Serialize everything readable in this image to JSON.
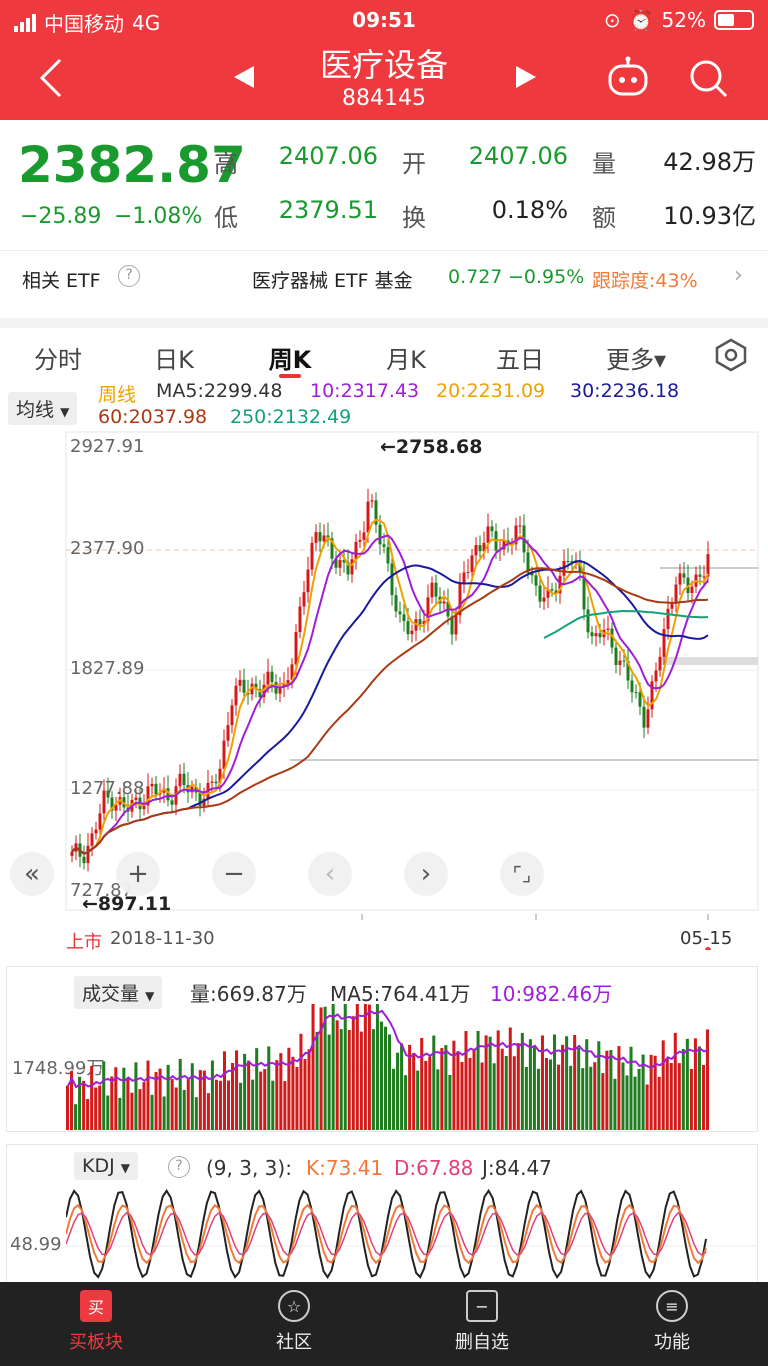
{
  "status_bar": {
    "carrier": "中国移动",
    "network": "4G",
    "time": "09:51",
    "battery": "52%"
  },
  "nav": {
    "title": "医疗设备",
    "code": "884145"
  },
  "quote": {
    "price": "2382.87",
    "change": "−25.89",
    "change_pct": "−1.08%",
    "high_label": "高",
    "high": "2407.06",
    "low_label": "低",
    "low": "2379.51",
    "open_label": "开",
    "open": "2407.06",
    "turnover_label": "换",
    "turnover": "0.18%",
    "volume_label": "量",
    "volume": "42.98万",
    "amount_label": "额",
    "amount": "10.93亿"
  },
  "etf": {
    "label": "相关 ETF",
    "name": "医疗器械 ETF 基金",
    "price": "0.727",
    "change": "−0.95%",
    "track": "跟踪度:43%"
  },
  "tabs": [
    {
      "label": "分时"
    },
    {
      "label": "日K"
    },
    {
      "label": "周K"
    },
    {
      "label": "月K"
    },
    {
      "label": "五日"
    },
    {
      "label": "更多▾"
    }
  ],
  "ma_legend": {
    "selector": "均线",
    "period": "周线",
    "ma5": "MA5:2299.48",
    "ma10": "10:2317.43",
    "ma20": "20:2231.09",
    "ma30": "30:2236.18",
    "ma60": "60:2037.98",
    "ma250": "250:2132.49"
  },
  "colors": {
    "ma5": "#e8a33a",
    "ma10": "#a01ed8",
    "ma20": "#f0a000",
    "ma30": "#1a1a9a",
    "ma60": "#a83a14",
    "ma250": "#15a07a",
    "up": "#d21a1a",
    "down": "#1f7d1f",
    "brand": "#ee3a3f"
  },
  "price_chart": {
    "y_labels": [
      "2927.91",
      "2377.90",
      "1827.89",
      "1277.88",
      "727.87"
    ],
    "max_marker": "←2758.68",
    "min_marker": "←897.11",
    "listing_label": "上市",
    "start_date": "2018-11-30",
    "end_date": "05-15"
  },
  "volume_panel": {
    "selector": "成交量",
    "vol": "量:669.87万",
    "ma5": "MA5:764.41万",
    "ma10": "10:982.46万",
    "y_label": "1748.99万"
  },
  "kdj_panel": {
    "selector": "KDJ",
    "params": "(9, 3, 3):",
    "k": "K:73.41",
    "d": "D:67.88",
    "j": "J:84.47",
    "y_label": "48.99"
  },
  "bottom_nav": [
    {
      "label": "买板块",
      "icon_char": "买"
    },
    {
      "label": "社区",
      "icon_char": "☆"
    },
    {
      "label": "删自选",
      "icon_char": "−"
    },
    {
      "label": "功能",
      "icon_char": "≡"
    }
  ],
  "chart_data": {
    "type": "candlestick",
    "y_range": [
      727.87,
      2927.91
    ],
    "close_path": [
      930,
      960,
      1030,
      1200,
      1230,
      1150,
      1190,
      1250,
      1240,
      1230,
      1280,
      1260,
      1240,
      1230,
      1370,
      1700,
      1730,
      1760,
      1740,
      1770,
      1760,
      1900,
      2300,
      2500,
      2420,
      2380,
      2300,
      2420,
      2680,
      2450,
      2300,
      2050,
      2000,
      2110,
      2200,
      2150,
      2050,
      2280,
      2420,
      2480,
      2430,
      2450,
      2500,
      2350,
      2200,
      2150,
      2310,
      2380,
      2250,
      1980,
      2010,
      1960,
      1850,
      1700,
      1620,
      1780,
      2050,
      2300,
      2200,
      2280,
      2380
    ]
  }
}
